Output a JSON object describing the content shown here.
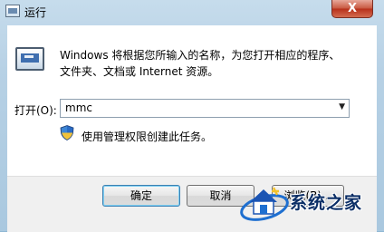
{
  "window": {
    "title": "运行",
    "close_glyph": "X"
  },
  "description": {
    "line1": "Windows 将根据您所输入的名称，为您打开相应的程序、",
    "line2": "文件夹、文档或 Internet 资源。"
  },
  "open_field": {
    "label": "打开(O):",
    "value": "mmc"
  },
  "admin_note": "使用管理权限创建此任务。",
  "buttons": {
    "ok": "确定",
    "cancel": "取消",
    "browse": "浏览(B)..."
  },
  "watermark": {
    "text": "系统之家"
  }
}
